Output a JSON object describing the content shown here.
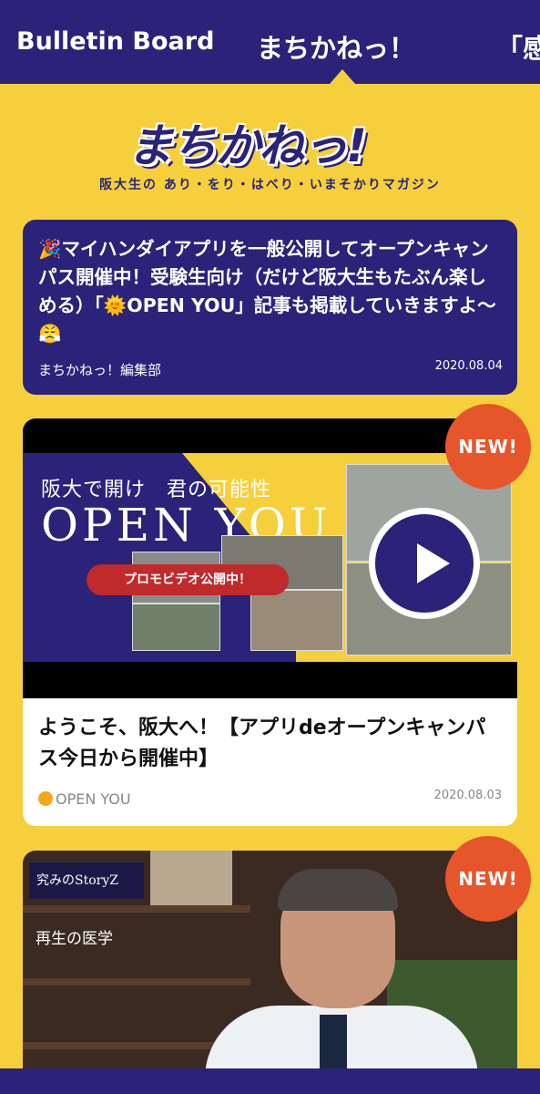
{
  "tabs": {
    "left": "Bulletin Board",
    "active": "まちかねっ！",
    "right": "「感"
  },
  "header": {
    "logo": "まちかねっ!",
    "tagline": "阪大生の あり・をり・はべり・いまそかりマガジン"
  },
  "notice": {
    "text": "🎉マイハンダイアプリを一般公開してオープンキャンパス開催中！受験生向け（だけど阪大生もたぶん楽しめる）「🌞OPEN YOU」記事も掲載していきますよ〜😤",
    "author": "まちかねっ！編集部",
    "date": "2020.08.04"
  },
  "cards": [
    {
      "badge": "NEW!",
      "thumb_line1": "阪大で開け　君の可能性",
      "thumb_line2": "OPEN YOU",
      "thumb_pill": "プロモビデオ公開中！",
      "title": "ようこそ、阪大へ！【アプリdeオープンキャンパス今日から開催中】",
      "category": "OPEN YOU",
      "date": "2020.08.03"
    },
    {
      "badge": "NEW!",
      "thumb_label": "究みのStoryZ",
      "thumb_sub": "再生の医学"
    }
  ],
  "colors": {
    "navy": "#2a2379",
    "yellow": "#f6cf3c",
    "badge_orange": "#e6562a"
  }
}
